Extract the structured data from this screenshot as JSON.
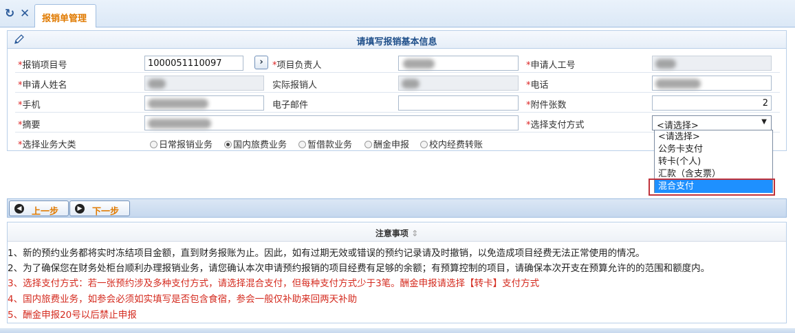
{
  "window": {
    "refresh_icon": "↻",
    "close_icon": "✕",
    "tab_label": "报销单管理"
  },
  "form": {
    "title": "请填写报销基本信息",
    "fields": {
      "project_no": {
        "label": "报销项目号",
        "value": "1000051110097"
      },
      "project_owner": {
        "label": "项目负责人"
      },
      "applicant_id": {
        "label": "申请人工号"
      },
      "applicant_name": {
        "label": "申请人姓名"
      },
      "actual_claimant": {
        "label": "实际报销人"
      },
      "phone": {
        "label": "电话"
      },
      "mobile": {
        "label": "手机"
      },
      "email": {
        "label": "电子邮件"
      },
      "attachments": {
        "label": "附件张数",
        "value": "2"
      },
      "summary": {
        "label": "摘要"
      },
      "payment": {
        "label": "选择支付方式",
        "value": "<请选择>"
      },
      "business_type": {
        "label": "选择业务大类"
      }
    },
    "required_mark": "*",
    "arrow_button": "›",
    "business_options": [
      {
        "label": "日常报销业务",
        "checked": false
      },
      {
        "label": "国内旅费业务",
        "checked": true
      },
      {
        "label": "暂借款业务",
        "checked": false
      },
      {
        "label": "酬金申报",
        "checked": false
      },
      {
        "label": "校内经费转账",
        "checked": false
      }
    ],
    "payment_options": [
      {
        "label": "<请选择>",
        "highlighted": false
      },
      {
        "label": "公务卡支付",
        "highlighted": false
      },
      {
        "label": "转卡(个人)",
        "highlighted": false
      },
      {
        "label": "汇款（含支票）",
        "highlighted": false
      },
      {
        "label": "混合支付",
        "highlighted": true
      }
    ]
  },
  "nav": {
    "prev_label": "上一步",
    "next_label": "下一步"
  },
  "notes": {
    "title": "注意事项",
    "sort_icon": "⇕",
    "items": [
      {
        "text": "1、新的预约业务都将实时冻结项目金额，直到财务报账为止。因此，如有过期无效或错误的预约记录请及时撤销，以免造成项目经费无法正常使用的情况。",
        "color": "#222222"
      },
      {
        "text": "2、为了确保您在财务处柜台顺利办理报销业务，请您确认本次申请预约报销的项目经费有足够的余额；有预算控制的项目，请确保本次开支在预算允许的的范围和额度内。",
        "color": "#222222"
      },
      {
        "text": "3、选择支付方式：若一张预约涉及多种支付方式，请选择混合支付，但每种支付方式少于3笔。酬金申报请选择【转卡】支付方式",
        "color": "#d42a1e"
      },
      {
        "text": "4、国内旅费业务，如参会必须如实填写是否包含食宿，参会一般仅补助来回两天补助",
        "color": "#d42a1e"
      },
      {
        "text": "5、酬金申报20号以后禁止申报",
        "color": "#d42a1e"
      }
    ]
  }
}
